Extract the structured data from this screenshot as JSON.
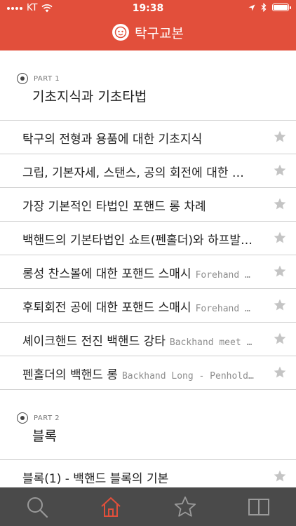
{
  "status_bar": {
    "carrier": "KT",
    "time": "19:38"
  },
  "header": {
    "title": "탁구교본",
    "logo_icon": "ping-pong-mascot-icon"
  },
  "sections": [
    {
      "part_label": "PART 1",
      "title": "기초지식과 기초타법",
      "items": [
        {
          "title": "탁구의 전형과 용품에 대한 기초지식",
          "subtitle": ""
        },
        {
          "title": "그립, 기본자세, 스탠스, 공의 회전에 대한 …",
          "subtitle": ""
        },
        {
          "title": "가장 기본적인 타법인 포핸드 롱 차례",
          "subtitle": ""
        },
        {
          "title": "백핸드의 기본타법인 쇼트(펜홀더)와 하프발…",
          "subtitle": ""
        },
        {
          "title": "롱성 찬스볼에 대한 포핸드 스매시",
          "subtitle": "Forehand …"
        },
        {
          "title": "후퇴회전 공에 대한 포핸드 스매시",
          "subtitle": "Forehand …"
        },
        {
          "title": "셰이크핸드 전진 백핸드 강타",
          "subtitle": "Backhand meet …"
        },
        {
          "title": "펜홀더의 백핸드 롱",
          "subtitle": "Backhand Long - Penhold…"
        }
      ]
    },
    {
      "part_label": "PART 2",
      "title": "블록",
      "items": [
        {
          "title": "블록(1) - 백핸드 블록의 기본",
          "subtitle": ""
        }
      ]
    }
  ],
  "tabbar": {
    "tabs": [
      {
        "icon": "search-icon",
        "active": false
      },
      {
        "icon": "home-icon",
        "active": true
      },
      {
        "icon": "star-icon",
        "active": false
      },
      {
        "icon": "book-icon",
        "active": false
      }
    ]
  },
  "colors": {
    "accent": "#e24f3b",
    "tabbar_bg": "#4a4a4a",
    "star_inactive": "#c4c4c4"
  }
}
